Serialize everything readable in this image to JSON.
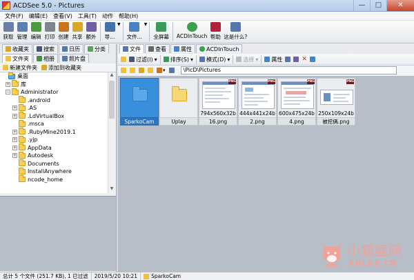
{
  "window": {
    "title": "ACDSee 5.0 - Pictures",
    "minimize": "—",
    "maximize": "□",
    "close": "✕"
  },
  "menu": [
    "文件(F)",
    "编辑(E)",
    "查看(V)",
    "工具(T)",
    "动作",
    "帮助(H)"
  ],
  "toolbar": [
    {
      "label": "获取",
      "icon": "acquire-icon",
      "color": "#6b7fa8"
    },
    {
      "label": "管理",
      "icon": "manage-icon",
      "color": "#5a7fb5"
    },
    {
      "label": "编辑",
      "icon": "edit-icon",
      "color": "#4a9a3e"
    },
    {
      "label": "打印",
      "icon": "print-icon",
      "color": "#7d8591"
    },
    {
      "label": "创建",
      "icon": "create-icon",
      "color": "#c9731c"
    },
    {
      "label": "共享",
      "icon": "share-icon",
      "color": "#d9a925"
    },
    {
      "label": "额外",
      "icon": "extra-icon",
      "color": "#6f5fa8"
    },
    {
      "label": "导...",
      "icon": "navigate-icon",
      "color": "#4670a8"
    },
    {
      "label": "文件...",
      "icon": "file-icon",
      "color": "#4a83c4"
    },
    {
      "label": "全屏幕",
      "icon": "fullscreen-icon",
      "color": "#3a9a5a"
    },
    {
      "label": "ACDInTouch",
      "icon": "acdintouch-icon",
      "color": "#3aa04a"
    },
    {
      "label": "帮助",
      "icon": "help-icon",
      "color": "#b0213e"
    },
    {
      "label": "这是什么?",
      "icon": "whats-this-icon",
      "color": "#5577aa"
    }
  ],
  "left_tabs_row1": [
    {
      "label": "收藏夹",
      "color": "#d9a925"
    },
    {
      "label": "搜索",
      "color": "#445577"
    },
    {
      "label": "日历",
      "color": "#5577aa"
    },
    {
      "label": "分类",
      "color": "#5fa05f"
    }
  ],
  "left_tabs_row2": [
    {
      "label": "文件夹",
      "color": "#f0c040"
    },
    {
      "label": "相册",
      "color": "#4a8a4a"
    },
    {
      "label": "照片盘",
      "color": "#5577aa"
    }
  ],
  "left_fav_bar": {
    "new_folder": "新建文件夹",
    "add_fav": "添加到收藏夹"
  },
  "tree": [
    {
      "label": "桌面",
      "depth": 0,
      "exp": ""
    },
    {
      "label": "库",
      "depth": 0,
      "exp": "+"
    },
    {
      "label": "Administrator",
      "depth": 0,
      "exp": "−"
    },
    {
      "label": ".android",
      "depth": 1,
      "exp": ""
    },
    {
      "label": ".AS",
      "depth": 1,
      "exp": "+"
    },
    {
      "label": ".LdVirtualBox",
      "depth": 1,
      "exp": "+"
    },
    {
      "label": ".msca",
      "depth": 1,
      "exp": ""
    },
    {
      "label": ".RubyMine2019.1",
      "depth": 1,
      "exp": "+"
    },
    {
      "label": ".yjp",
      "depth": 1,
      "exp": "+"
    },
    {
      "label": "AppData",
      "depth": 1,
      "exp": "+"
    },
    {
      "label": "Autodesk",
      "depth": 1,
      "exp": "+"
    },
    {
      "label": "Documents",
      "depth": 1,
      "exp": ""
    },
    {
      "label": "InstallAnywhere",
      "depth": 1,
      "exp": ""
    },
    {
      "label": "ncode_home",
      "depth": 1,
      "exp": ""
    }
  ],
  "right_tabs": [
    {
      "label": "文件",
      "color": "#5577aa"
    },
    {
      "label": "查看",
      "color": "#666666"
    },
    {
      "label": "属性",
      "color": "#4a83c4"
    },
    {
      "label": "ACDInTouch",
      "color": "#3aa04a"
    }
  ],
  "right_toolbar": {
    "filter": "过滤(I)",
    "sort": "排序(S)",
    "mode": "模式(D)",
    "select": "选择",
    "properties": "属性"
  },
  "path": "\\PicD\\Pictures",
  "thumbnails": [
    {
      "name": "SparkoCam",
      "dims": "",
      "kind": "folder-blue",
      "selected": true
    },
    {
      "name": "Uplay",
      "dims": "",
      "kind": "folder",
      "selected": false
    },
    {
      "name": "16.png",
      "dims": "794x560x32b",
      "kind": "png",
      "selected": false
    },
    {
      "name": "2.png",
      "dims": "444x441x24b",
      "kind": "png",
      "selected": false
    },
    {
      "name": "4.png",
      "dims": "600x475x24b",
      "kind": "png",
      "selected": false
    },
    {
      "name": "被挖俩.png",
      "dims": "250x109x24b",
      "kind": "png-small",
      "selected": false
    }
  ],
  "png_badge": "PNG",
  "status": {
    "summary": "总计 5 个文件 (251.7 KB), 1 已过滤",
    "date": "2019/5/20 10:21",
    "selected": "SparkoCam"
  },
  "watermark": {
    "text": "小狐狸网",
    "url": "XHLKS.CN"
  }
}
